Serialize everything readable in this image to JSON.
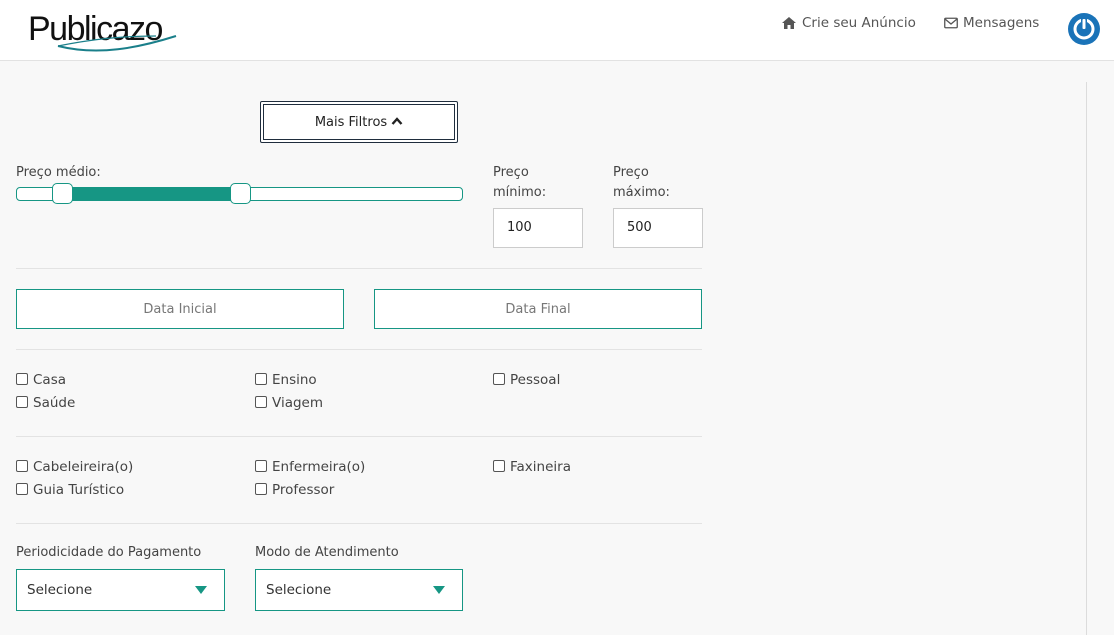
{
  "header": {
    "logo_text": "Publicazo",
    "create_ad_label": "Crie seu Anúncio",
    "messages_label": "Mensagens"
  },
  "filters": {
    "more_filters_label": "Mais Filtros",
    "avg_price_label": "Preço médio:",
    "min_price_label_line1": "Preço",
    "min_price_label_line2": "mínimo:",
    "max_price_label_line1": "Preço",
    "max_price_label_line2": "máximo:",
    "min_price_value": "100",
    "max_price_value": "500",
    "slider_min_fraction": 0.1,
    "slider_max_fraction": 0.5,
    "start_date_label": "Data Inicial",
    "end_date_label": "Data Final",
    "categories": [
      {
        "label": "Casa",
        "checked": false
      },
      {
        "label": "Ensino",
        "checked": false
      },
      {
        "label": "Pessoal",
        "checked": false
      },
      {
        "label": "Saúde",
        "checked": false
      },
      {
        "label": "Viagem",
        "checked": false
      }
    ],
    "professions": [
      {
        "label": "Cabeleireira(o)",
        "checked": false
      },
      {
        "label": "Enfermeira(o)",
        "checked": false
      },
      {
        "label": "Faxineira",
        "checked": false
      },
      {
        "label": "Guia Turístico",
        "checked": false
      },
      {
        "label": "Professor",
        "checked": false
      }
    ],
    "payment_frequency_label": "Periodicidade do Pagamento",
    "payment_frequency_value": "Selecione",
    "service_mode_label": "Modo de Atendimento",
    "service_mode_value": "Selecione"
  },
  "colors": {
    "accent": "#169684",
    "power_button": "#1a73b8"
  }
}
